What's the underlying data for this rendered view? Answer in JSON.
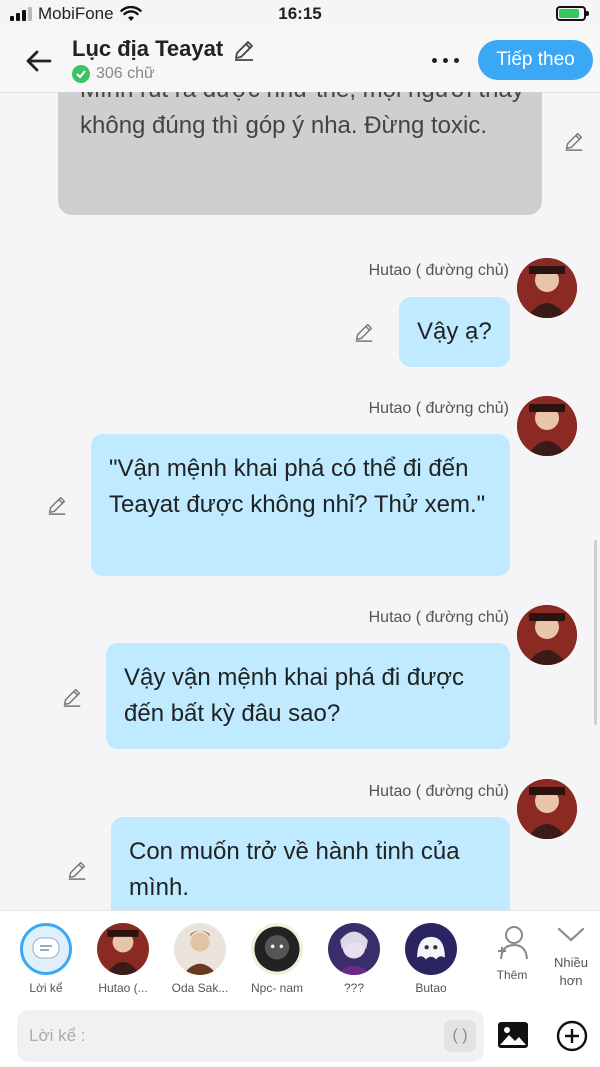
{
  "status": {
    "carrier": "MobiFone",
    "time": "16:15"
  },
  "header": {
    "title": "Lục địa Teayat",
    "word_count": "306 chữ",
    "next_label": "Tiếp theo"
  },
  "chat": {
    "narration": "Mình rút ra được như thế, mọi người thấy không đúng thì góp ý nha. Đừng toxic.",
    "messages": [
      {
        "speaker": "Hutao ( đường chủ)",
        "text": "Vậy ạ?"
      },
      {
        "speaker": "Hutao ( đường chủ)",
        "text": "\"Vận mệnh khai phá có thể đi đến Teayat được không nhỉ? Thử xem.\""
      },
      {
        "speaker": "Hutao ( đường chủ)",
        "text": "Vậy vận mệnh khai phá đi được đến bất kỳ đâu sao?"
      },
      {
        "speaker": "Hutao ( đường chủ)",
        "text": "Con muốn trở về hành tinh của mình."
      }
    ]
  },
  "characters": [
    {
      "label": "Lời kể"
    },
    {
      "label": "Hutao (..."
    },
    {
      "label": "Oda Sak..."
    },
    {
      "label": "Npc- nam"
    },
    {
      "label": "???"
    },
    {
      "label": "Butao"
    }
  ],
  "actions": {
    "add_label": "Thêm",
    "more_label": "Nhiều hơn"
  },
  "input": {
    "placeholder": "Lời kể :",
    "paren": "( )"
  },
  "colors": {
    "accent": "#3aa8f5",
    "bubble": "#bfeaff",
    "narration_bg": "#cfcfcf"
  }
}
